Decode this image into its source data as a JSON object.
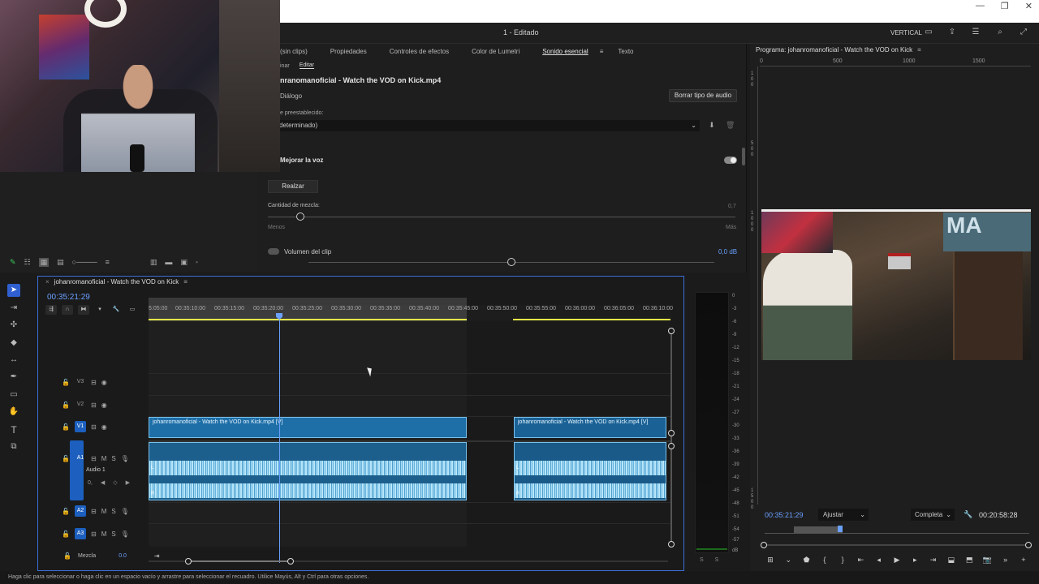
{
  "window": {
    "project_name": "1 - Editado",
    "vertical_label": "VERTICAL",
    "controls": [
      "—",
      "❐",
      "✕"
    ]
  },
  "essential_sound": {
    "tabs": [
      "(sin clips)",
      "Propiedades",
      "Controles de efectos",
      "Color de Lumetri",
      "Sonido esencial",
      "Texto"
    ],
    "active_tab": "Sonido esencial",
    "subtabs": [
      "inar",
      "Editar"
    ],
    "clip_title": "nranomanoficial - Watch the VOD on Kick.mp4",
    "audio_type": "Diálogo",
    "clear_type_button": "Borrar tipo de audio",
    "preset_label": "e preestablecido:",
    "preset_value": "determinado)",
    "enhance_voice_label": "Mejorar la voz",
    "enhance_button": "Realzar",
    "mix_amount_label": "Cantidad de mezcla:",
    "mix_amount_value": "0,7",
    "mix_amount_fraction": 0.07,
    "mix_less": "Menos",
    "mix_more": "Más",
    "clip_volume_label": "Volumen del clip",
    "clip_volume_value": "0,0 dB",
    "clip_volume_fraction": 0.5
  },
  "program_monitor": {
    "title": "Programa: johanromanoficial - Watch the VOD on Kick",
    "ruler_labels": [
      "0",
      "500",
      "1000",
      "1500"
    ],
    "vruler_labels": [
      "1",
      "0",
      "0",
      "5",
      "0",
      "0",
      "1",
      "0",
      "0",
      "0",
      "1",
      "5",
      "0",
      "0"
    ],
    "sign_text": "MA",
    "timecode": "00:35:21:29",
    "fit_select": "Ajustar",
    "quality_select": "Completa",
    "duration": "00:20:58:28"
  },
  "timeline": {
    "sequence_name": "johanromanoficial - Watch the VOD on Kick",
    "timecode": "00:35:21:29",
    "ruler_labels": [
      "5:05:00",
      "00:35:10:00",
      "00:35:15:00",
      "00:35:20:00",
      "00:35:25:00",
      "00:35:30:00",
      "00:35:35:00",
      "00:35:40:00",
      "00:35:45:00",
      "00:35:50:00",
      "00:35:55:00",
      "00:36:00:00",
      "00:36:05:00",
      "00:36:10:00"
    ],
    "tracks": {
      "v3": "V3",
      "v2": "V2",
      "v1": "V1",
      "a1": "A1",
      "a1_name": "Audio 1",
      "a2": "A2",
      "a3": "A3",
      "mix": "Mezcla",
      "mix_value": "0.0"
    },
    "clip_video_label": "johanromanoficial - Watch the VOD on Kick.mp4 [V]",
    "clip_video_label_2": "johanromanoficial - Watch the VOD on Kick.mp4 [V]"
  },
  "meter": {
    "db_labels": [
      "0",
      "-3",
      "-6",
      "-9",
      "-12",
      "-15",
      "-18",
      "-21",
      "-24",
      "-27",
      "-30",
      "-33",
      "-36",
      "-39",
      "-42",
      "-45",
      "-48",
      "-51",
      "-54",
      "-57",
      "dB"
    ],
    "solo_labels": [
      "S",
      "S"
    ]
  },
  "status_bar": "Haga clic para seleccionar o haga clic en un espacio vacío y arrastre para seleccionar el recuadro. Utilice Mayús, Alt y Ctrl para otras opciones.",
  "colors": {
    "accent": "#6aa0ff",
    "clip": "#1e6fa8",
    "workarea": "#e6e64a"
  }
}
